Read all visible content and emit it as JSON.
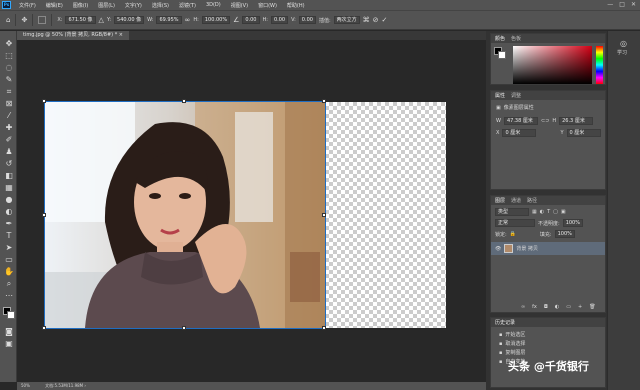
{
  "app": {
    "logo": "Ps"
  },
  "menubar": {
    "items": [
      "文件(F)",
      "编辑(E)",
      "图像(I)",
      "图层(L)",
      "文字(Y)",
      "选择(S)",
      "滤镜(T)",
      "3D(D)",
      "视图(V)",
      "窗口(W)",
      "帮助(H)"
    ]
  },
  "window_controls": [
    "—",
    "□",
    "✕"
  ],
  "options": {
    "x_label": "X:",
    "x_value": "671.50 像",
    "y_label": "Y:",
    "y_value": "540.00 像",
    "w_label": "W:",
    "w_value": "69.95%",
    "h_label": "H:",
    "h_value": "100.00%",
    "angle_value": "0.00",
    "hskew_label": "H:",
    "hskew_value": "0.00",
    "vskew_label": "V:",
    "vskew_value": "0.00",
    "interp_label": "插值:",
    "interp_value": "两次立方"
  },
  "document": {
    "tab_title": "timg.jpg @ 50% (背景 拷贝, RGB/8#) *"
  },
  "status": {
    "zoom": "50%",
    "doc_info": "文档:5.53M/11.98M"
  },
  "panels": {
    "color": {
      "tabs": [
        "颜色",
        "色板"
      ]
    },
    "properties": {
      "tabs": [
        "属性",
        "调整"
      ],
      "subtitle": "像素图层属性",
      "w_label": "W",
      "w_value": "47.38 厘米",
      "h_label": "H",
      "h_value": "26.3 厘米",
      "x_label": "X",
      "x_value": "0 厘米",
      "y_label": "Y",
      "y_value": "0 厘米"
    },
    "layers": {
      "tabs": [
        "图层",
        "通道",
        "路径"
      ],
      "kind_label": "类型",
      "blend_mode": "正常",
      "opacity_label": "不透明度:",
      "opacity_value": "100%",
      "lock_label": "锁定:",
      "fill_label": "填充:",
      "fill_value": "100%",
      "items": [
        {
          "name": "背景 拷贝",
          "visible": true
        }
      ]
    },
    "history": {
      "tabs": [
        "历史记录"
      ],
      "items": [
        "开始选区",
        "取消选择",
        "复制图层",
        "自由变换"
      ]
    }
  },
  "side_strip": {
    "learn_label": "学习"
  },
  "watermark": {
    "text": "头条 @千货银行"
  }
}
